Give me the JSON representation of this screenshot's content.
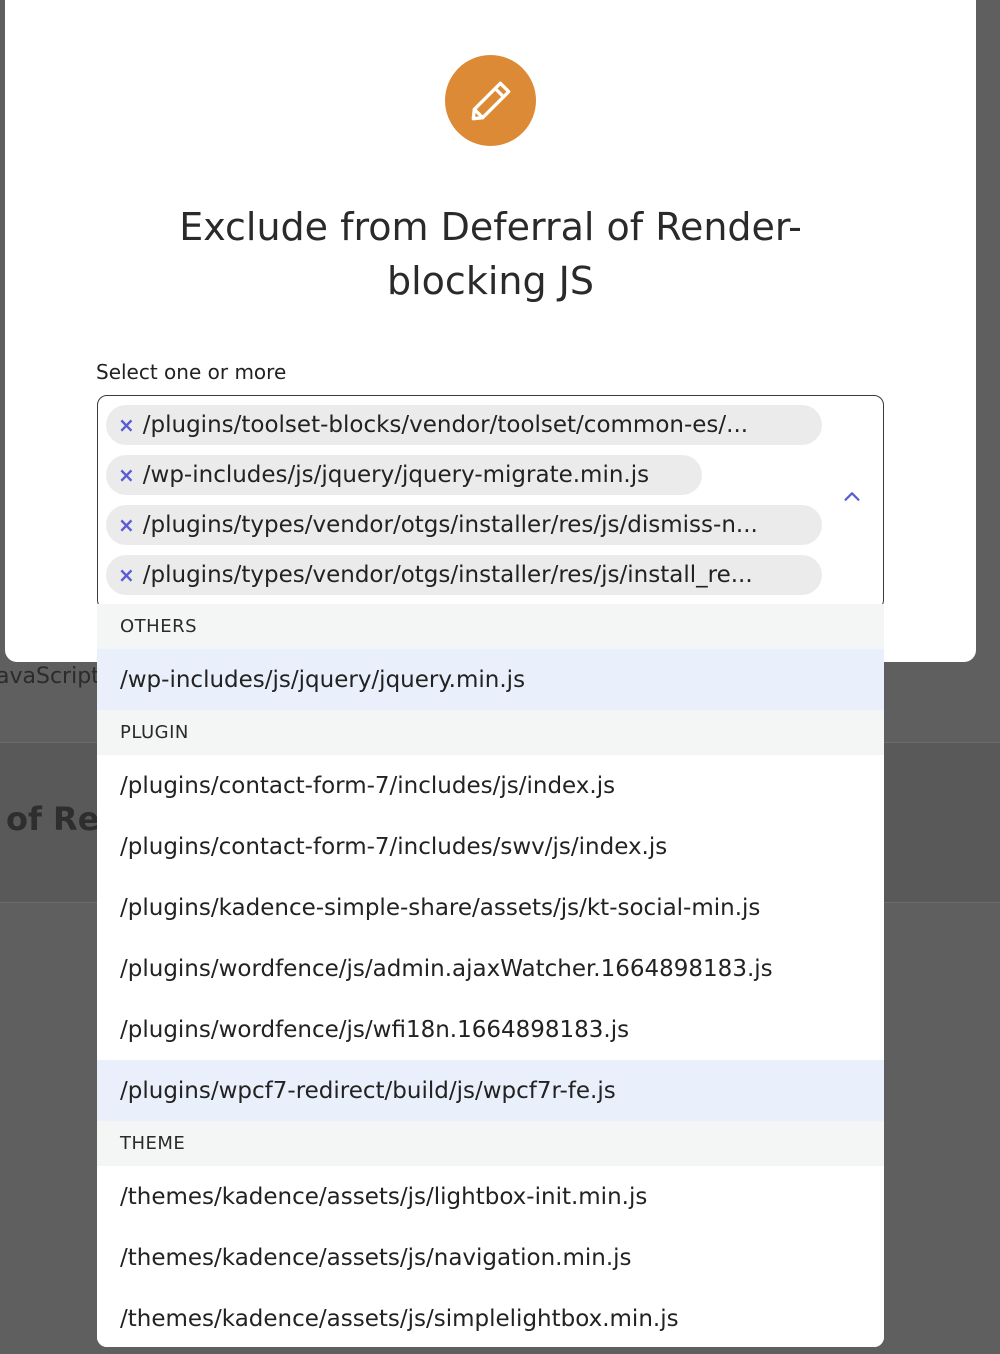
{
  "background": {
    "text_js": "avaScript",
    "text_render": "of Rer"
  },
  "modal": {
    "icon": "pencil-icon",
    "accent_color": "#dc8a35",
    "title": "Exclude from Deferral of Render-blocking JS",
    "field_label": "Select one or more",
    "selected_chips": [
      "/plugins/toolset-blocks/vendor/toolset/common-es/...",
      "/wp-includes/js/jquery/jquery-migrate.min.js",
      "/plugins/types/vendor/otgs/installer/res/js/dismiss-n...",
      "/plugins/types/vendor/otgs/installer/res/js/install_re..."
    ],
    "remove_glyph": "×"
  },
  "dropdown": {
    "groups": [
      {
        "label": "OTHERS",
        "options": [
          "/wp-includes/js/jquery/jquery.min.js"
        ]
      },
      {
        "label": "PLUGIN",
        "options": [
          "/plugins/contact-form-7/includes/js/index.js",
          "/plugins/contact-form-7/includes/swv/js/index.js",
          "/plugins/kadence-simple-share/assets/js/kt-social-min.js",
          "/plugins/wordfence/js/admin.ajaxWatcher.1664898183.js",
          "/plugins/wordfence/js/wfi18n.1664898183.js",
          "/plugins/wpcf7-redirect/build/js/wpcf7r-fe.js"
        ]
      },
      {
        "label": "THEME",
        "options": [
          "/themes/kadence/assets/js/lightbox-init.min.js",
          "/themes/kadence/assets/js/navigation.min.js",
          "/themes/kadence/assets/js/simplelightbox.min.js"
        ]
      }
    ]
  }
}
